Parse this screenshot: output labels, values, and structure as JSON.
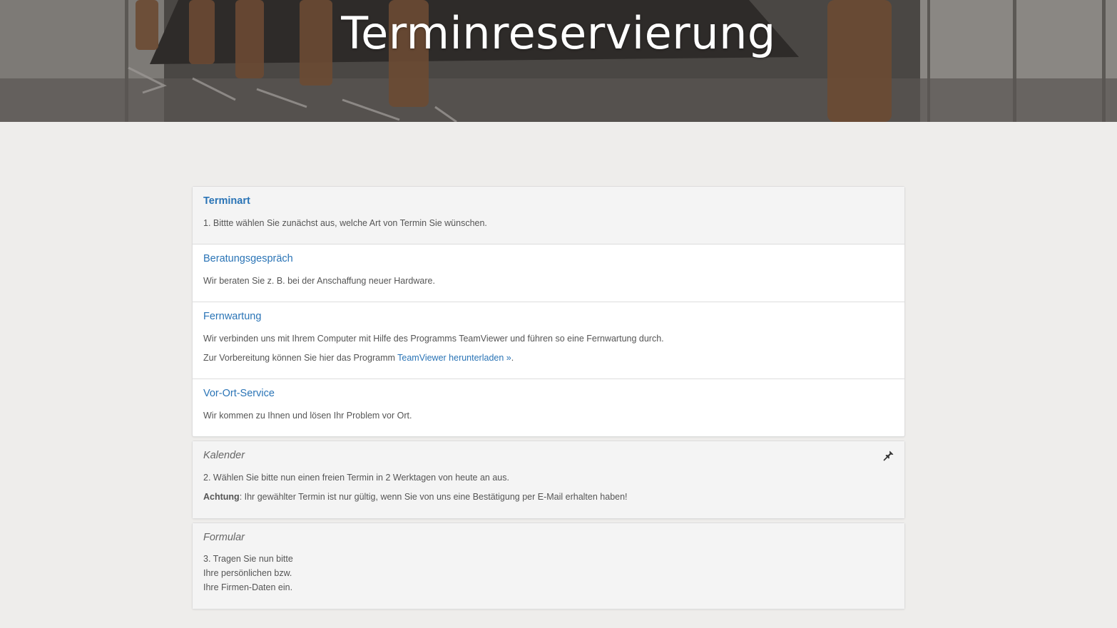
{
  "hero": {
    "title": "Terminreservierung"
  },
  "terminart": {
    "title": "Terminart",
    "text": "1. Bittte wählen Sie zunächst aus, welche Art von Termin Sie wünschen."
  },
  "options": [
    {
      "title": "Beratungsgespräch",
      "text": "Wir beraten Sie z. B. bei der Anschaffung neuer Hardware."
    },
    {
      "title": "Fernwartung",
      "text": "Wir verbinden uns mit Ihrem Computer mit Hilfe des Programms TeamViewer und führen so eine Fernwartung durch.",
      "text2_prefix": "Zur Vorbereitung können Sie hier das Programm ",
      "link": "TeamViewer herunterladen »",
      "text2_suffix": "."
    },
    {
      "title": "Vor-Ort-Service",
      "text": "Wir kommen zu Ihnen und lösen Ihr Problem vor Ort."
    }
  ],
  "kalender": {
    "title": "Kalender",
    "text": "2. Wählen Sie bitte nun einen freien Termin in 2 Werktagen von heute an aus.",
    "warning_label": "Achtung",
    "warning_text": ": Ihr gewählter Termin ist nur gültig, wenn Sie von uns eine Bestätigung per E-Mail erhalten haben!",
    "icon": "pin-icon"
  },
  "formular": {
    "title": "Formular",
    "lines": [
      "3. Tragen Sie nun bitte",
      "Ihre persönlichen bzw.",
      "Ihre Firmen-Daten ein."
    ]
  }
}
